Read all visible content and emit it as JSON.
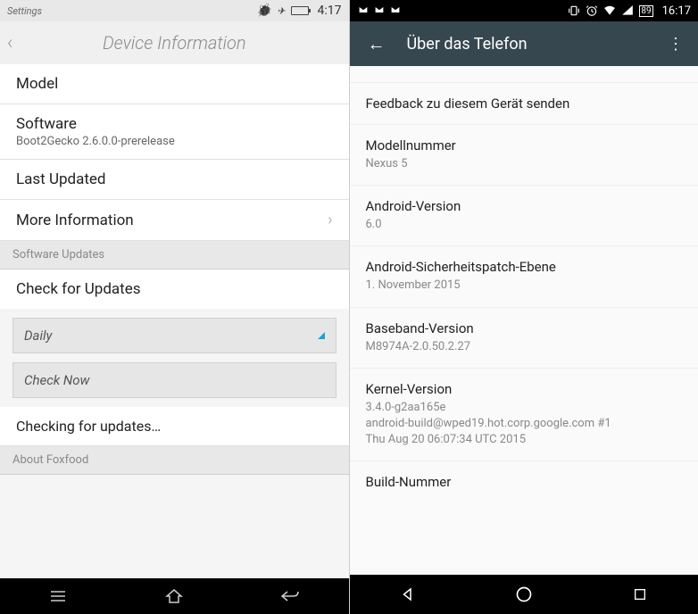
{
  "left": {
    "status": {
      "label": "Settings",
      "time": "4:17"
    },
    "header": {
      "title": "Device Information"
    },
    "items": {
      "model": "Model",
      "software": {
        "label": "Software",
        "value": "Boot2Gecko 2.6.0.0-prerelease"
      },
      "lastUpdated": "Last Updated",
      "moreInfo": "More Information"
    },
    "sectionUpdates": "Software Updates",
    "checkForUpdates": "Check for Updates",
    "frequency": "Daily",
    "checkNow": "Check Now",
    "checking": "Checking for updates…",
    "sectionAbout": "About Foxfood"
  },
  "right": {
    "status": {
      "battery": "89",
      "time": "16:17"
    },
    "header": {
      "title": "Über das Telefon"
    },
    "feedback": "Feedback zu diesem Gerät senden",
    "model": {
      "label": "Modellnummer",
      "value": "Nexus 5"
    },
    "android": {
      "label": "Android-Version",
      "value": "6.0"
    },
    "patch": {
      "label": "Android-Sicherheitspatch-Ebene",
      "value": "1. November 2015"
    },
    "baseband": {
      "label": "Baseband-Version",
      "value": "M8974A-2.0.50.2.27"
    },
    "kernel": {
      "label": "Kernel-Version",
      "value": "3.4.0-g2aa165e\nandroid-build@wped19.hot.corp.google.com #1\nThu Aug 20 06:07:34 UTC 2015"
    },
    "build": {
      "label": "Build-Nummer"
    }
  }
}
